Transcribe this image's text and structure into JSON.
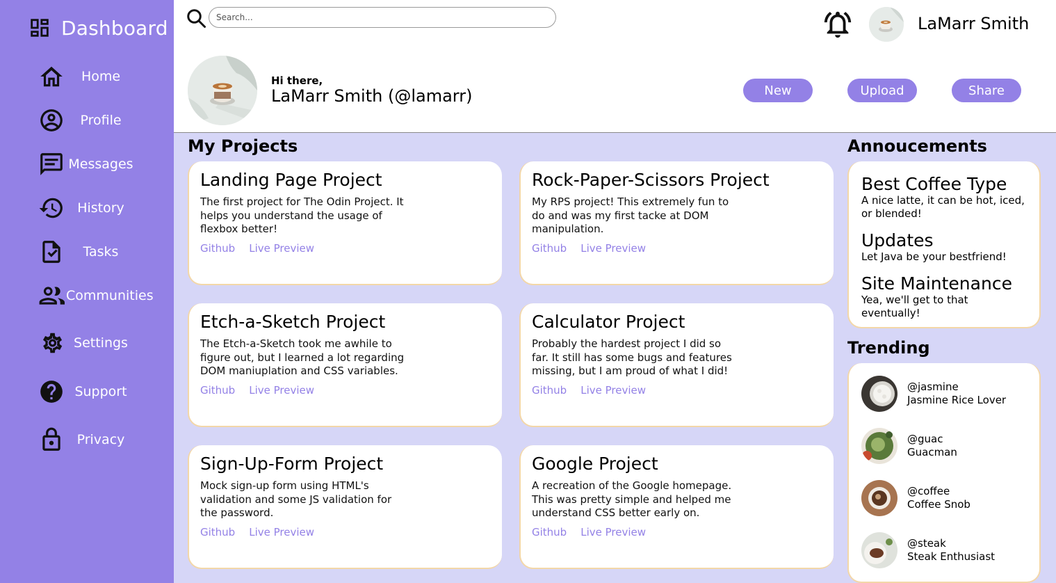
{
  "sidebar": {
    "brand": "Dashboard",
    "items": [
      {
        "label": "Home",
        "icon": "home-icon"
      },
      {
        "label": "Profile",
        "icon": "profile-icon"
      },
      {
        "label": "Messages",
        "icon": "messages-icon"
      },
      {
        "label": "History",
        "icon": "history-icon"
      },
      {
        "label": "Tasks",
        "icon": "tasks-icon"
      },
      {
        "label": "Communities",
        "icon": "communities-icon"
      },
      {
        "label": "Settings",
        "icon": "gear-icon"
      },
      {
        "label": "Support",
        "icon": "help-icon"
      },
      {
        "label": "Privacy",
        "icon": "lock-icon"
      }
    ]
  },
  "header": {
    "search_placeholder": "Search...",
    "user_name": "LaMarr Smith",
    "greeting": "Hi there,",
    "greeting_name": "LaMarr Smith (@lamarr)",
    "buttons": {
      "new": "New",
      "upload": "Upload",
      "share": "Share"
    }
  },
  "projects": {
    "title": "My Projects",
    "items": [
      {
        "title": "Landing Page Project",
        "desc": "The first project for The Odin Project. It helps you understand the usage of flexbox better!",
        "github": "Github",
        "preview": "Live Preview"
      },
      {
        "title": "Rock-Paper-Scissors Project",
        "desc": "My RPS project! This extremely fun to do and was my first tacke at DOM manipulation.",
        "github": "Github",
        "preview": "Live Preview"
      },
      {
        "title": "Etch-a-Sketch Project",
        "desc": "The Etch-a-Sketch took me awhile to figure out, but I learned a lot regarding DOM maniuplation and CSS variables.",
        "github": "Github",
        "preview": "Live Preview"
      },
      {
        "title": "Calculator Project",
        "desc": "Probably the hardest project I did so far. It still has some bugs and features missing, but I am proud of what I did!",
        "github": "Github",
        "preview": "Live Preview"
      },
      {
        "title": "Sign-Up-Form Project",
        "desc": "Mock sign-up form using HTML's validation and some JS validation for the password.",
        "github": "Github",
        "preview": "Live Preview"
      },
      {
        "title": "Google Project",
        "desc": "A recreation of the Google homepage. This was pretty simple and helped me understand CSS better early on.",
        "github": "Github",
        "preview": "Live Preview"
      }
    ]
  },
  "announcements": {
    "title": "Annoucements",
    "items": [
      {
        "title": "Best Coffee Type",
        "body": "A nice latte, it can be hot, iced, or blended!"
      },
      {
        "title": "Updates",
        "body": "Let Java be your bestfriend!"
      },
      {
        "title": "Site Maintenance",
        "body": "Yea, we'll get to that eventually!"
      }
    ]
  },
  "trending": {
    "title": "Trending",
    "items": [
      {
        "handle": "@jasmine",
        "name": "Jasmine Rice Lover"
      },
      {
        "handle": "@guac",
        "name": "Guacman"
      },
      {
        "handle": "@coffee",
        "name": "Coffee Snob"
      },
      {
        "handle": "@steak",
        "name": "Steak Enthusiast"
      }
    ]
  },
  "colors": {
    "accent": "#9381e6",
    "background": "#d6d6f7",
    "card_border": "#f3d7a8"
  }
}
